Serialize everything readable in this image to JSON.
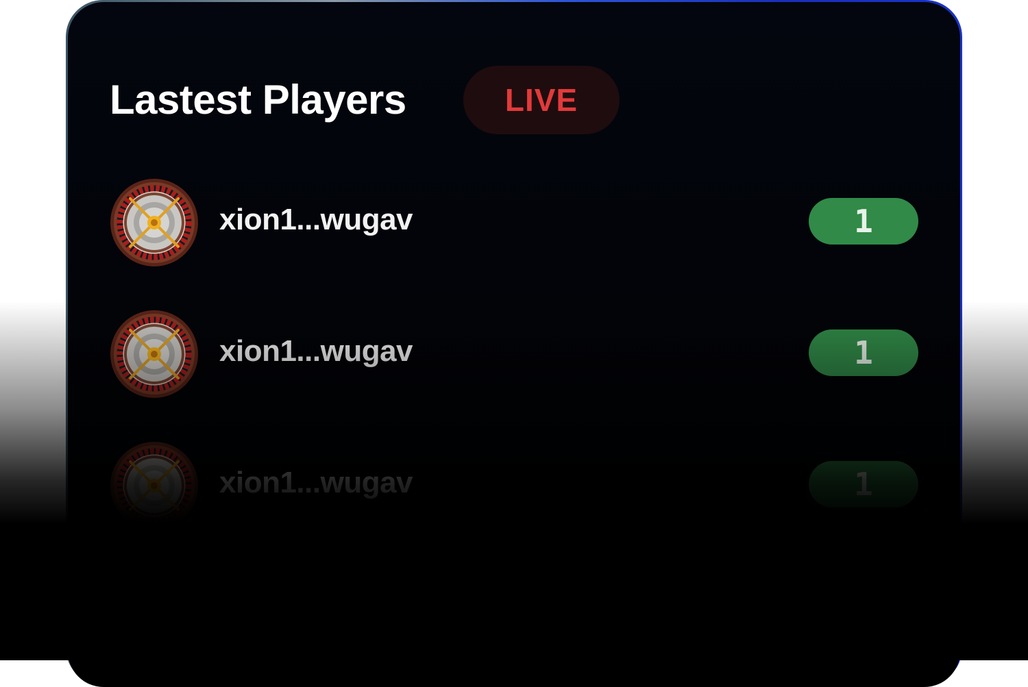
{
  "header": {
    "title": "Lastest Players",
    "live_label": "LIVE"
  },
  "players": [
    {
      "address": "xion1...wugav",
      "count": "1",
      "avatar_icon": "roulette-wheel-icon"
    },
    {
      "address": "xion1...wugav",
      "count": "1",
      "avatar_icon": "roulette-wheel-icon"
    },
    {
      "address": "xion1...wugav",
      "count": "1",
      "avatar_icon": "roulette-wheel-icon"
    }
  ],
  "colors": {
    "live_text": "#e23a3a",
    "live_bg": "#1f0c0e",
    "badge_bg": "#318a48",
    "border_accent": "#1a33c8"
  }
}
